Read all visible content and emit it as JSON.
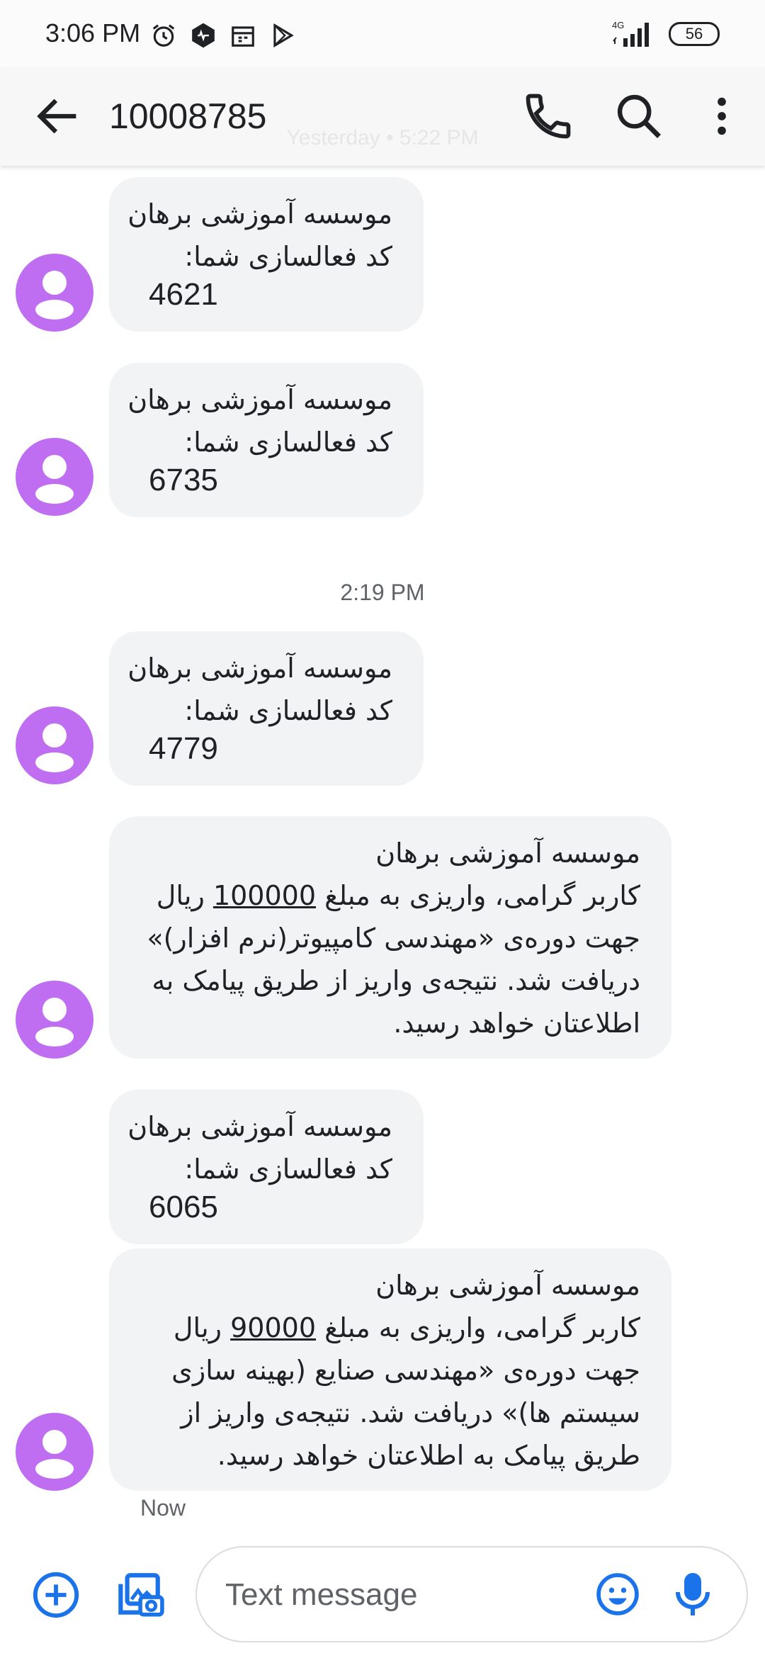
{
  "status_bar": {
    "time": "3:06 PM",
    "network": "4G",
    "battery": "56"
  },
  "header": {
    "title": "10008785",
    "ghost_timestamp": "Yesterday • 5:22 PM"
  },
  "messages": [
    {
      "lines": [
        "موسسه آموزشی برهان",
        "کد فعالسازی شما:"
      ],
      "code": "4621"
    },
    {
      "lines": [
        "موسسه آموزشی برهان",
        "کد فعالسازی شما:"
      ],
      "code": "6735"
    },
    {
      "lines": [
        "موسسه آموزشی برهان",
        "کد فعالسازی شما:"
      ],
      "code": "4779"
    },
    {
      "lines": [
        "موسسه آموزشی برهان",
        "کاربر گرامی، واریزی به مبلغ",
        "100000",
        "ریال",
        "جهت دوره‌ی «مهندسی کامپیوتر(نرم افزار)»",
        "دریافت شد. نتیجه‌ی واریز از طریق پیامک به",
        "اطلاعتان خواهد رسید."
      ]
    },
    {
      "lines": [
        "موسسه آموزشی برهان",
        "کد فعالسازی شما:"
      ],
      "code": "6065"
    },
    {
      "lines": [
        "موسسه آموزشی برهان",
        "کاربر گرامی، واریزی به مبلغ",
        "90000",
        "ریال",
        "جهت دوره‌ی «مهندسی صنایع (بهینه سازی",
        "سیستم ها)» دریافت شد. نتیجه‌ی واریز از",
        "طریق پیامک به اطلاعتان خواهد رسید."
      ]
    }
  ],
  "timestamps": {
    "divider": "2:19 PM",
    "last": "Now"
  },
  "composer": {
    "placeholder": "Text message"
  },
  "colors": {
    "avatar": "#c06ef1",
    "bubble": "#f1f3f4",
    "accent": "#1a73e8"
  }
}
